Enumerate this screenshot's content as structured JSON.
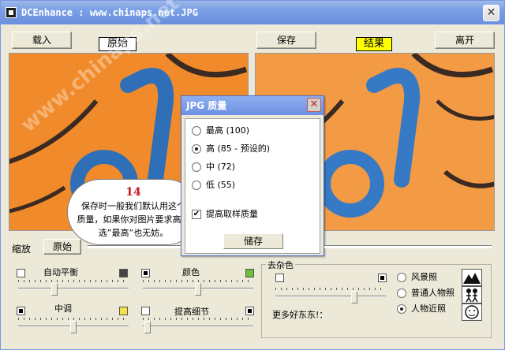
{
  "window": {
    "title": "DCEnhance : www.chinaps.net.JPG",
    "close_glyph": "✕"
  },
  "toolbar": {
    "load_label": "载入",
    "original_tag": "原始",
    "save_label": "保存",
    "result_tag": "结果",
    "exit_label": "离开"
  },
  "watermark": "www.chinaps.net",
  "dialog": {
    "title": "JPG 质量",
    "close_glyph": "✕",
    "options": [
      {
        "label": "最高 (100)",
        "selected": false
      },
      {
        "label": "高 (85 - 预设的)",
        "selected": true
      },
      {
        "label": "中 (72)",
        "selected": false
      },
      {
        "label": "低 (55)",
        "selected": false
      }
    ],
    "checkbox_label": "提高取样质量",
    "checkbox_checked": true,
    "save_label": "储存"
  },
  "callout": {
    "number": "14",
    "line1": "保存时一般我们默认用这个",
    "line2": "质量，如果你对图片要求高，",
    "line3": "选”最高”也无妨。"
  },
  "zoom": {
    "label": "缩放",
    "original_button": "原始"
  },
  "controls": {
    "auto_balance": "自动平衡",
    "color": "颜色",
    "midtone": "中调",
    "detail": "提高细节"
  },
  "denoise": {
    "group_title": "去杂色",
    "more_label": "更多好东东!：",
    "scenes": [
      {
        "label": "风景照",
        "selected": false
      },
      {
        "label": "普通人物照",
        "selected": false
      },
      {
        "label": "人物近照",
        "selected": true
      }
    ]
  },
  "colors": {
    "orange": "#f08a2a",
    "blue": "#2f6fb8",
    "result_tag_bg": "#ffff00"
  }
}
